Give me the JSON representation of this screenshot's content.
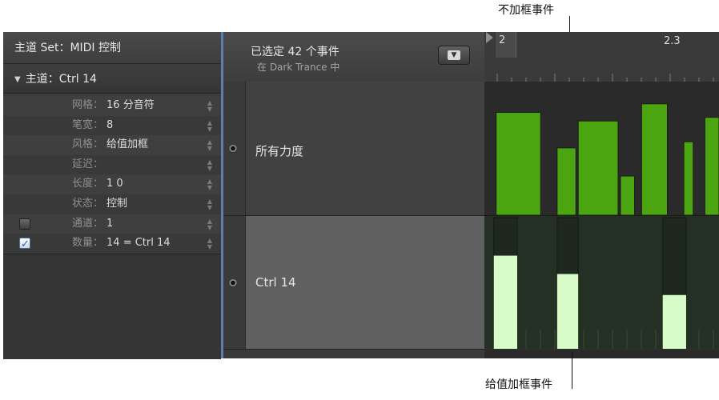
{
  "inspector": {
    "title": "主道 Set：MIDI 控制",
    "subtitle": "主道：Ctrl 14",
    "params": [
      {
        "label": "网格",
        "value": "16 分音符",
        "checkbox": null
      },
      {
        "label": "笔宽",
        "value": "8",
        "checkbox": null
      },
      {
        "label": "风格",
        "value": "给值加框",
        "checkbox": null
      },
      {
        "label": "延迟",
        "value": "",
        "checkbox": null
      },
      {
        "label": "长度",
        "value": "1 0",
        "checkbox": null
      },
      {
        "label": "状态",
        "value": "控制",
        "checkbox": null
      },
      {
        "label": "通道",
        "value": "1",
        "checkbox": false
      },
      {
        "label": "数量",
        "value": "14 = Ctrl 14",
        "checkbox": true
      }
    ]
  },
  "header": {
    "selection": "已选定 42 个事件",
    "location": "在 Dark Trance 中",
    "menu_icon": "menu-chevron-icon"
  },
  "lanes": [
    {
      "name": "所有力度"
    },
    {
      "name": "Ctrl 14"
    }
  ],
  "ruler": {
    "playhead_label": "2",
    "bar_label": "2.3"
  },
  "velocity_events": [
    {
      "start": 0.05,
      "end": 0.24,
      "value": 0.84
    },
    {
      "start": 0.31,
      "end": 0.39,
      "value": 0.55
    },
    {
      "start": 0.4,
      "end": 0.57,
      "value": 0.77
    },
    {
      "start": 0.58,
      "end": 0.64,
      "value": 0.32
    },
    {
      "start": 0.67,
      "end": 0.78,
      "value": 0.91
    },
    {
      "start": 0.85,
      "end": 0.89,
      "value": 0.6
    },
    {
      "start": 0.94,
      "end": 1.0,
      "value": 0.8
    }
  ],
  "ctrl_events": [
    {
      "start": 0.04,
      "end": 0.14,
      "value": 0.71
    },
    {
      "start": 0.31,
      "end": 0.4,
      "value": 0.57
    },
    {
      "start": 0.76,
      "end": 0.86,
      "value": 0.41
    }
  ],
  "callouts": {
    "top": "不加框事件",
    "bottom": "给值加框事件"
  },
  "colors": {
    "velocity_fill": "#4aa510",
    "ctrl_fill": "#d8fcc8",
    "ctrl_box": "#1f281e"
  }
}
